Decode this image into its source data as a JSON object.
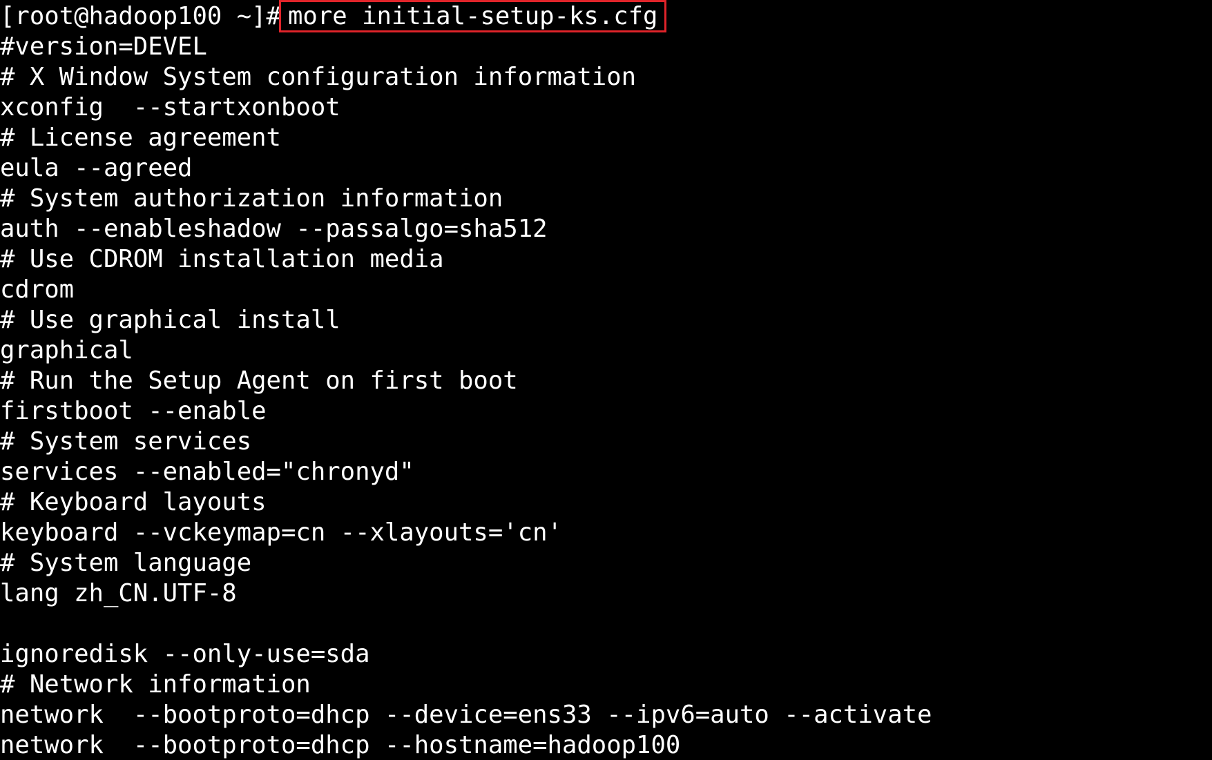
{
  "terminal": {
    "prompt": "[root@hadoop100 ~]#",
    "command": "more initial-setup-ks.cfg",
    "highlight_color": "#e0242a",
    "background_color": "#000000",
    "text_color": "#ffffff",
    "lines": [
      "#version=DEVEL",
      "# X Window System configuration information",
      "xconfig  --startxonboot",
      "# License agreement",
      "eula --agreed",
      "# System authorization information",
      "auth --enableshadow --passalgo=sha512",
      "# Use CDROM installation media",
      "cdrom",
      "# Use graphical install",
      "graphical",
      "# Run the Setup Agent on first boot",
      "firstboot --enable",
      "# System services",
      "services --enabled=\"chronyd\"",
      "# Keyboard layouts",
      "keyboard --vckeymap=cn --xlayouts='cn'",
      "# System language",
      "lang zh_CN.UTF-8",
      "",
      "ignoredisk --only-use=sda",
      "# Network information",
      "network  --bootproto=dhcp --device=ens33 --ipv6=auto --activate",
      "network  --bootproto=dhcp --hostname=hadoop100"
    ]
  }
}
